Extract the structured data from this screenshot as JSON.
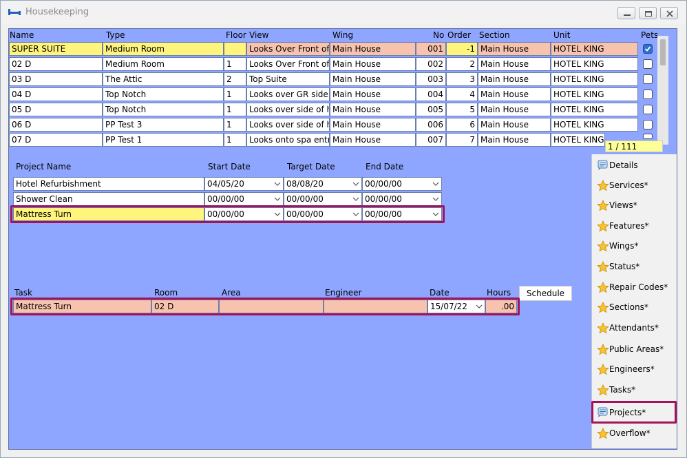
{
  "window": {
    "title": "Housekeeping"
  },
  "rooms": {
    "headers": {
      "name": "Name",
      "type": "Type",
      "floor": "Floor",
      "view": "View",
      "wing": "Wing",
      "no": "No",
      "order": "Order",
      "section": "Section",
      "unit": "Unit",
      "pets": "Pets"
    },
    "rows": [
      {
        "name": "SUPER SUITE",
        "type": "Medium Room",
        "floor": "",
        "view": "Looks Over Front of",
        "wing": "Main House",
        "no": "001",
        "order": "-1",
        "section": "Main House",
        "unit": "HOTEL KING",
        "pets": true
      },
      {
        "name": "02 D",
        "type": "Medium Room",
        "floor": "1",
        "view": "Looks Over Front of",
        "wing": "Main House",
        "no": "002",
        "order": "2",
        "section": "Main House",
        "unit": "HOTEL KING",
        "pets": false
      },
      {
        "name": "03 D",
        "type": "The Attic",
        "floor": "2",
        "view": "Top Suite",
        "wing": "Main House",
        "no": "003",
        "order": "3",
        "section": "Main House",
        "unit": "HOTEL KING",
        "pets": false
      },
      {
        "name": "04 D",
        "type": "Top Notch",
        "floor": "1",
        "view": "Looks over GR side",
        "wing": "Main House",
        "no": "004",
        "order": "4",
        "section": "Main House",
        "unit": "HOTEL KING",
        "pets": false
      },
      {
        "name": "05 D",
        "type": "Top Notch",
        "floor": "1",
        "view": "Looks over side of h",
        "wing": "Main House",
        "no": "005",
        "order": "5",
        "section": "Main House",
        "unit": "HOTEL KING",
        "pets": false
      },
      {
        "name": "06 D",
        "type": "PP Test 3",
        "floor": "1",
        "view": "Looks over side of h",
        "wing": "Main House",
        "no": "006",
        "order": "6",
        "section": "Main House",
        "unit": "HOTEL KING",
        "pets": false
      },
      {
        "name": "07 D",
        "type": "PP Test 1",
        "floor": "1",
        "view": "Looks onto spa entr",
        "wing": "Main House",
        "no": "007",
        "order": "7",
        "section": "Main House",
        "unit": "HOTEL KING",
        "pets": false
      }
    ],
    "record_counter": "1 / 111"
  },
  "projects": {
    "headers": {
      "name": "Project Name",
      "start": "Start Date",
      "target": "Target Date",
      "end": "End Date"
    },
    "rows": [
      {
        "name": "Hotel Refurbishment",
        "start": "04/05/20",
        "target": "08/08/20",
        "end": "00/00/00"
      },
      {
        "name": "Shower Clean",
        "start": "00/00/00",
        "target": "00/00/00",
        "end": "00/00/00"
      },
      {
        "name": "Mattress Turn",
        "start": "00/00/00",
        "target": "00/00/00",
        "end": "00/00/00"
      }
    ]
  },
  "tasks": {
    "headers": {
      "task": "Task",
      "room": "Room",
      "area": "Area",
      "engineer": "Engineer",
      "date": "Date",
      "hours": "Hours"
    },
    "schedule_label": "Schedule",
    "rows": [
      {
        "task": "Mattress Turn",
        "room": "02 D",
        "area": "",
        "engineer": "",
        "date": "15/07/22",
        "hours": ".00"
      }
    ]
  },
  "side_panel": {
    "items": [
      {
        "label": "Details",
        "icon": "details-icon"
      },
      {
        "label": "Services*",
        "icon": "star-icon"
      },
      {
        "label": "Views*",
        "icon": "star-icon"
      },
      {
        "label": "Features*",
        "icon": "star-icon"
      },
      {
        "label": "Wings*",
        "icon": "star-icon"
      },
      {
        "label": "Status*",
        "icon": "star-icon"
      },
      {
        "label": "Repair Codes*",
        "icon": "star-icon"
      },
      {
        "label": "Sections*",
        "icon": "star-icon"
      },
      {
        "label": "Attendants*",
        "icon": "star-icon"
      },
      {
        "label": "Public Areas*",
        "icon": "star-icon"
      },
      {
        "label": "Engineers*",
        "icon": "star-icon"
      },
      {
        "label": "Tasks*",
        "icon": "star-icon"
      },
      {
        "label": "Projects*",
        "icon": "projects-icon"
      },
      {
        "label": "Overflow*",
        "icon": "star-icon"
      }
    ]
  },
  "colors": {
    "content_bg": "#8ea6ff",
    "selected_row": "#f7c3ae",
    "selected_name": "#fff47c",
    "highlight_border": "#a3135a"
  }
}
